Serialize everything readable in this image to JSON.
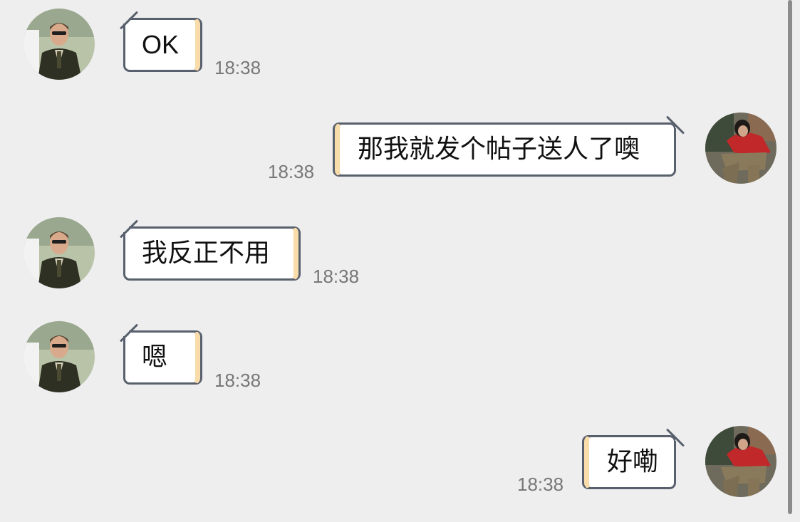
{
  "messages": [
    {
      "side": "left",
      "avatar": "contact-avatar",
      "text": "OK",
      "time": "18:38"
    },
    {
      "side": "right",
      "avatar": "self-avatar",
      "text": "那我就发个帖子送人了噢",
      "time": "18:38"
    },
    {
      "side": "left",
      "avatar": "contact-avatar",
      "text": "我反正不用",
      "time": "18:38"
    },
    {
      "side": "left",
      "avatar": "contact-avatar",
      "text": "嗯",
      "time": "18:38"
    },
    {
      "side": "right",
      "avatar": "self-avatar",
      "text": "好嘞",
      "time": "18:38"
    }
  ],
  "colors": {
    "background": "#eeeeee",
    "bubble_fill": "#ffffff",
    "bubble_border": "#59606d",
    "bubble_accent": "#f8dcaa",
    "timestamp": "#777777"
  }
}
